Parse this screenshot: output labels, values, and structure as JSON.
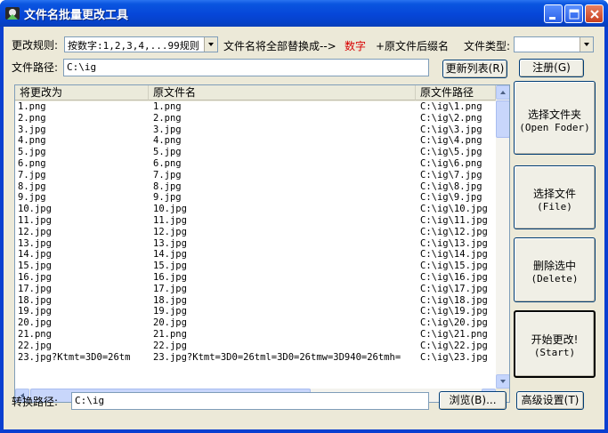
{
  "window": {
    "title": "文件名批量更改工具"
  },
  "controls": {
    "rule_label": "更改规则:",
    "rule_value": "按数字:1,2,3,4,...99规则",
    "replace_text": "文件名将全部替换成-->",
    "number_text": "数字",
    "suffix_text": "+原文件后缀名",
    "filetype_label": "文件类型:",
    "filetype_value": "",
    "path_label": "文件路径:",
    "path_value": "C:\\ig",
    "refresh_button": "更新列表(R)",
    "register_button": "注册(G)"
  },
  "list": {
    "columns": [
      "将更改为",
      "原文件名",
      "原文件路径"
    ],
    "rows": [
      [
        "1.png",
        "1.png",
        "C:\\ig\\1.png"
      ],
      [
        "2.png",
        "2.png",
        "C:\\ig\\2.png"
      ],
      [
        "3.jpg",
        "3.jpg",
        "C:\\ig\\3.jpg"
      ],
      [
        "4.png",
        "4.png",
        "C:\\ig\\4.png"
      ],
      [
        "5.jpg",
        "5.jpg",
        "C:\\ig\\5.jpg"
      ],
      [
        "6.png",
        "6.png",
        "C:\\ig\\6.png"
      ],
      [
        "7.jpg",
        "7.jpg",
        "C:\\ig\\7.jpg"
      ],
      [
        "8.jpg",
        "8.jpg",
        "C:\\ig\\8.jpg"
      ],
      [
        "9.jpg",
        "9.jpg",
        "C:\\ig\\9.jpg"
      ],
      [
        "10.jpg",
        "10.jpg",
        "C:\\ig\\10.jpg"
      ],
      [
        "11.jpg",
        "11.jpg",
        "C:\\ig\\11.jpg"
      ],
      [
        "12.jpg",
        "12.jpg",
        "C:\\ig\\12.jpg"
      ],
      [
        "13.jpg",
        "13.jpg",
        "C:\\ig\\13.jpg"
      ],
      [
        "14.jpg",
        "14.jpg",
        "C:\\ig\\14.jpg"
      ],
      [
        "15.jpg",
        "15.jpg",
        "C:\\ig\\15.jpg"
      ],
      [
        "16.jpg",
        "16.jpg",
        "C:\\ig\\16.jpg"
      ],
      [
        "17.jpg",
        "17.jpg",
        "C:\\ig\\17.jpg"
      ],
      [
        "18.jpg",
        "18.jpg",
        "C:\\ig\\18.jpg"
      ],
      [
        "19.jpg",
        "19.jpg",
        "C:\\ig\\19.jpg"
      ],
      [
        "20.jpg",
        "20.jpg",
        "C:\\ig\\20.jpg"
      ],
      [
        "21.png",
        "21.png",
        "C:\\ig\\21.png"
      ],
      [
        "22.jpg",
        "22.jpg",
        "C:\\ig\\22.jpg"
      ],
      [
        "23.jpg?Ktmt=3D0=26tm",
        "23.jpg?Ktmt=3D0=26tml=3D0=26tmw=3D940=26tmh=",
        "C:\\ig\\23.jpg"
      ]
    ]
  },
  "side_buttons": {
    "open_folder_1": "选择文件夹",
    "open_folder_2": "(Open Foder)",
    "file_1": "选择文件",
    "file_2": "(File)",
    "delete_1": "删除选中",
    "delete_2": "(Delete)",
    "start_1": "开始更改!",
    "start_2": "(Start)"
  },
  "bottom": {
    "convert_label": "转换路径:",
    "convert_value": "C:\\ig",
    "browse_button": "浏览(B)...",
    "advanced_button": "高级设置(T)"
  }
}
